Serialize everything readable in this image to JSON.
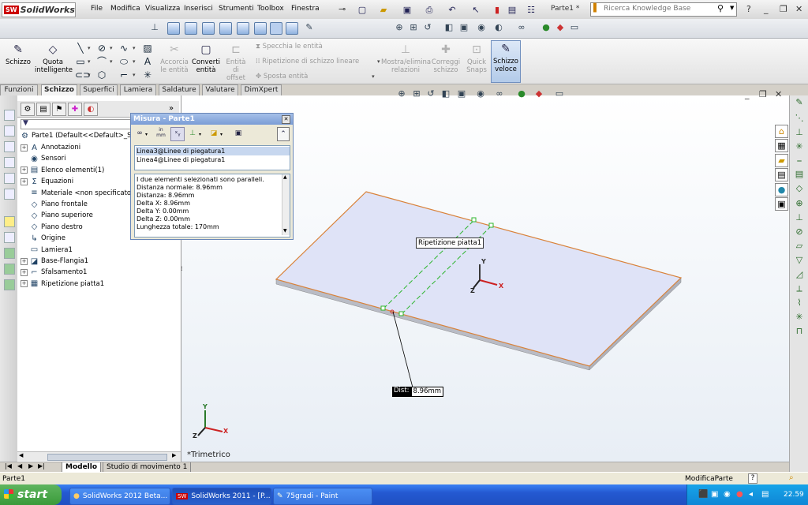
{
  "app": {
    "logo_text": "SolidWorks",
    "logo_badge": "SW",
    "menu": [
      "File",
      "Modifica",
      "Visualizza",
      "Inserisci",
      "Strumenti",
      "Toolbox",
      "Finestra"
    ],
    "document_title": "Parte1 *",
    "kb_search_placeholder": "Ricerca Knowledge Base"
  },
  "command_manager": {
    "schizzo": "Schizzo",
    "quota": "Quota intelligente",
    "accorcia": "Accorcia le entità",
    "converti": "Converti entità",
    "offset": "Entità di offset",
    "specchia": "Specchia le entità",
    "ripetizione": "Ripetizione di schizzo lineare",
    "sposta": "Sposta entità",
    "mostra": "Mostra/elimina relazioni",
    "correggi": "Correggi schizzo",
    "quick_snaps": "Quick Snaps",
    "schizzo_veloce": "Schizzo veloce"
  },
  "tabs": [
    "Funzioni",
    "Schizzo",
    "Superfici",
    "Lamiera",
    "Saldature",
    "Valutare",
    "DimXpert"
  ],
  "active_tab": "Schizzo",
  "feature_tree": {
    "root": "Parte1  (Default<<Default>_Sta",
    "items": [
      {
        "label": "Annotazioni",
        "expand": true,
        "icon": "annotations-icon",
        "glyph": "A"
      },
      {
        "label": "Sensori",
        "expand": false,
        "icon": "sensor-icon",
        "glyph": "◉"
      },
      {
        "label": "Elenco elementi(1)",
        "expand": true,
        "icon": "cut-list-icon",
        "glyph": "▤"
      },
      {
        "label": "Equazioni",
        "expand": true,
        "icon": "equations-icon",
        "glyph": "Σ"
      },
      {
        "label": "Materiale <non specificato>",
        "expand": false,
        "icon": "material-icon",
        "glyph": "≡"
      },
      {
        "label": "Piano frontale",
        "expand": false,
        "icon": "plane-icon",
        "glyph": "◇"
      },
      {
        "label": "Piano superiore",
        "expand": false,
        "icon": "plane-icon",
        "glyph": "◇"
      },
      {
        "label": "Piano destro",
        "expand": false,
        "icon": "plane-icon",
        "glyph": "◇"
      },
      {
        "label": "Origine",
        "expand": false,
        "icon": "origin-icon",
        "glyph": "↳"
      },
      {
        "label": "Lamiera1",
        "expand": false,
        "icon": "sheet-metal-icon",
        "glyph": "▭"
      },
      {
        "label": "Base-Flangia1",
        "expand": true,
        "icon": "base-flange-icon",
        "glyph": "◪"
      },
      {
        "label": "Sfalsamento1",
        "expand": true,
        "icon": "jog-icon",
        "glyph": "⌐"
      },
      {
        "label": "Ripetizione piatta1",
        "expand": true,
        "icon": "flat-pattern-icon",
        "glyph": "▦"
      }
    ]
  },
  "measure": {
    "title": "Misura - Parte1",
    "units": "in\nmm",
    "selections": [
      "Linea3@Linee di piegatura1",
      "Linea4@Linee di piegatura1"
    ],
    "results": [
      "I due elementi selezionati sono paralleli.",
      "Distanza normale: 8.96mm",
      "Distanza: 8.96mm",
      "Delta X: 8.96mm",
      "Delta Y: 0.00mm",
      "Delta Z: 0.00mm",
      "Lunghezza totale: 170mm"
    ]
  },
  "viewport": {
    "callout": "Ripetizione piatta1",
    "dist_label": "Dist:",
    "dist_value": "8.96mm",
    "view_name": "*Trimetrico",
    "axis_x": "X",
    "axis_y": "Y",
    "axis_z": "Z",
    "plate_edge_color": "#d9823a",
    "plate_face_color": "#dfe3f7",
    "bend_line_color": "#2cb52c"
  },
  "bottom_tabs": [
    "Modello",
    "Studio di movimento 1"
  ],
  "status": {
    "left": "Parte1",
    "right": "ModificaParte",
    "help": "?"
  },
  "taskbar": {
    "start": "start",
    "tasks": [
      "SolidWorks 2012 Beta...",
      "SolidWorks 2011 - [P...",
      "75gradi - Paint"
    ],
    "clock": "22.59"
  }
}
